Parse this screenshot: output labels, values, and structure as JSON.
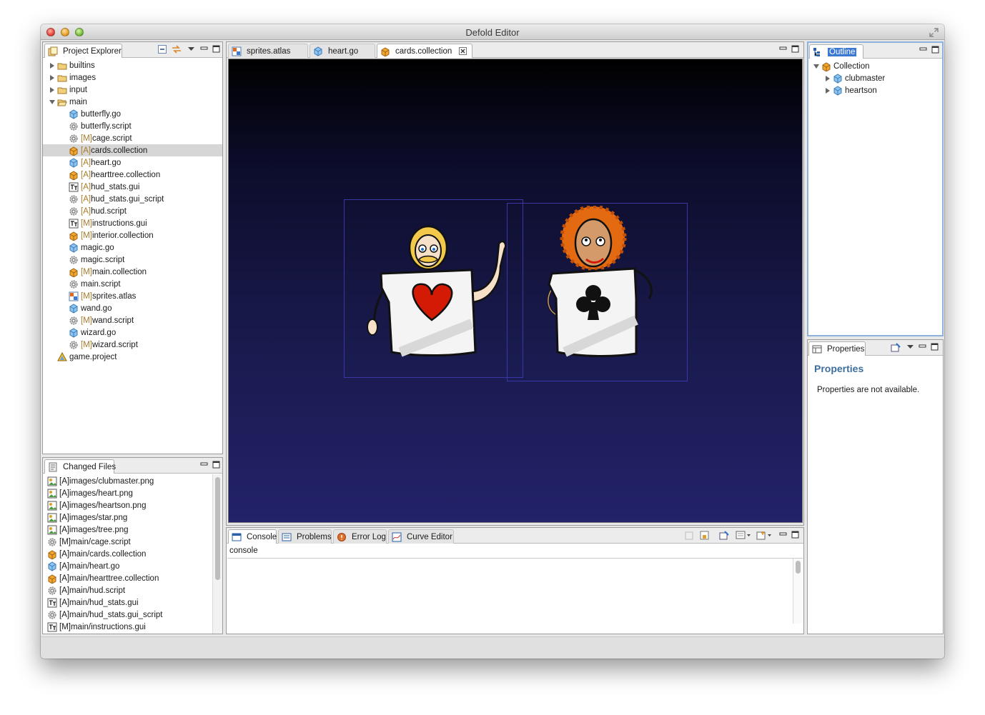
{
  "window": {
    "title": "Defold Editor"
  },
  "project_explorer": {
    "title": "Project Explorer",
    "items": [
      {
        "label": "builtins",
        "prefix": "",
        "icon": "folder-icon",
        "expander": "collapsed"
      },
      {
        "label": "images",
        "prefix": "",
        "icon": "folder-icon",
        "expander": "collapsed"
      },
      {
        "label": "input",
        "prefix": "",
        "icon": "folder-icon",
        "expander": "collapsed"
      },
      {
        "label": "main",
        "prefix": "",
        "icon": "folder-open-icon",
        "expander": "expanded"
      },
      {
        "label": "butterfly.go",
        "prefix": "",
        "icon": "gameobject-icon"
      },
      {
        "label": "butterfly.script",
        "prefix": "",
        "icon": "script-gear-icon"
      },
      {
        "label": "cage.script",
        "prefix": "[M]",
        "icon": "script-gear-icon"
      },
      {
        "label": "cards.collection",
        "prefix": "[A]",
        "icon": "collection-icon",
        "selected": true
      },
      {
        "label": "heart.go",
        "prefix": "[A]",
        "icon": "gameobject-icon"
      },
      {
        "label": "hearttree.collection",
        "prefix": "[A]",
        "icon": "collection-icon"
      },
      {
        "label": "hud_stats.gui",
        "prefix": "[A]",
        "icon": "gui-icon"
      },
      {
        "label": "hud_stats.gui_script",
        "prefix": "[A]",
        "icon": "script-gear-icon"
      },
      {
        "label": "hud.script",
        "prefix": "[A]",
        "icon": "script-gear-icon"
      },
      {
        "label": "instructions.gui",
        "prefix": "[M]",
        "icon": "gui-icon"
      },
      {
        "label": "interior.collection",
        "prefix": "[M]",
        "icon": "collection-icon"
      },
      {
        "label": "magic.go",
        "prefix": "",
        "icon": "gameobject-icon"
      },
      {
        "label": "magic.script",
        "prefix": "",
        "icon": "script-gear-icon"
      },
      {
        "label": "main.collection",
        "prefix": "[M]",
        "icon": "collection-icon"
      },
      {
        "label": "main.script",
        "prefix": "",
        "icon": "script-gear-icon"
      },
      {
        "label": "sprites.atlas",
        "prefix": "[M]",
        "icon": "atlas-icon"
      },
      {
        "label": "wand.go",
        "prefix": "",
        "icon": "gameobject-icon"
      },
      {
        "label": "wand.script",
        "prefix": "[M]",
        "icon": "script-gear-icon"
      },
      {
        "label": "wizard.go",
        "prefix": "",
        "icon": "gameobject-icon"
      },
      {
        "label": "wizard.script",
        "prefix": "[M]",
        "icon": "script-gear-icon"
      },
      {
        "label": "game.project",
        "prefix": "",
        "icon": "project-icon"
      }
    ]
  },
  "changed_files": {
    "title": "Changed Files",
    "items": [
      {
        "label": "[A]images/clubmaster.png",
        "icon": "image-file-icon"
      },
      {
        "label": "[A]images/heart.png",
        "icon": "image-file-icon"
      },
      {
        "label": "[A]images/heartson.png",
        "icon": "image-file-icon"
      },
      {
        "label": "[A]images/star.png",
        "icon": "image-file-icon"
      },
      {
        "label": "[A]images/tree.png",
        "icon": "image-file-icon"
      },
      {
        "label": "[M]main/cage.script",
        "icon": "script-gear-icon"
      },
      {
        "label": "[A]main/cards.collection",
        "icon": "collection-icon"
      },
      {
        "label": "[A]main/heart.go",
        "icon": "gameobject-icon"
      },
      {
        "label": "[A]main/hearttree.collection",
        "icon": "collection-icon"
      },
      {
        "label": "[A]main/hud.script",
        "icon": "script-gear-icon"
      },
      {
        "label": "[A]main/hud_stats.gui",
        "icon": "gui-icon"
      },
      {
        "label": "[A]main/hud_stats.gui_script",
        "icon": "script-gear-icon"
      },
      {
        "label": "[M]main/instructions.gui",
        "icon": "gui-icon"
      }
    ]
  },
  "editor_tabs": [
    {
      "label": "sprites.atlas",
      "icon": "atlas-icon"
    },
    {
      "label": "heart.go",
      "icon": "gameobject-icon"
    },
    {
      "label": "cards.collection",
      "icon": "collection-icon",
      "active": true,
      "closable": true
    }
  ],
  "outline": {
    "title": "Outline",
    "root": "Collection",
    "children": [
      "clubmaster",
      "heartson"
    ]
  },
  "properties": {
    "tab": "Properties",
    "heading": "Properties",
    "message": "Properties are not available."
  },
  "console": {
    "tabs": [
      {
        "label": "Console",
        "icon": "console-icon",
        "active": true
      },
      {
        "label": "Problems",
        "icon": "problems-icon"
      },
      {
        "label": "Error Log",
        "icon": "error-log-icon"
      },
      {
        "label": "Curve Editor",
        "icon": "curve-editor-icon"
      }
    ],
    "name": "console"
  },
  "colors": {
    "selection_bg": "#d6d6d6",
    "active_tab_highlight": "#3a78d2",
    "heading_blue": "#3e6e9e",
    "viewport_top": "#000000",
    "viewport_bottom": "#23226a",
    "bbox_outline": "#3b36a6"
  }
}
